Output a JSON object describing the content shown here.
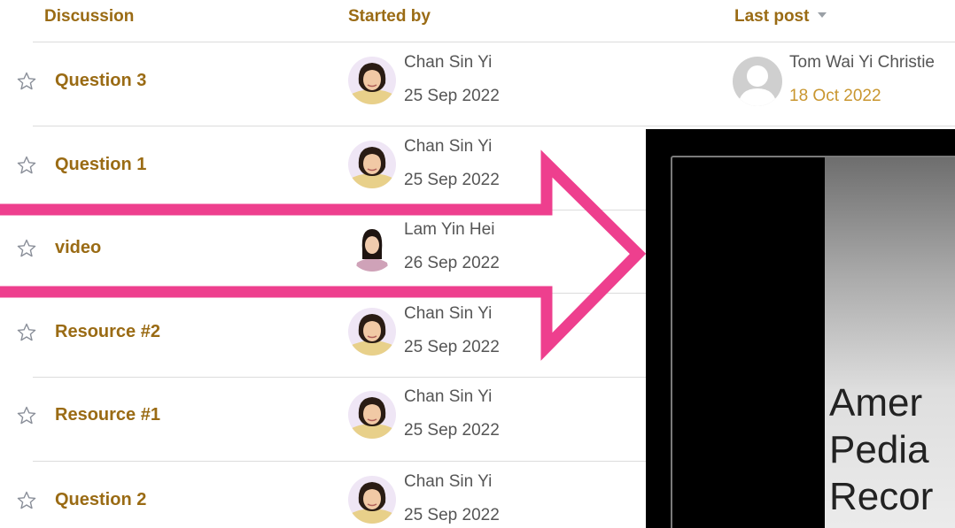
{
  "header": {
    "discussion": "Discussion",
    "started_by": "Started by",
    "last_post": "Last post"
  },
  "rows": [
    {
      "title": "Question 3",
      "author": "Chan Sin Yi",
      "date": "25 Sep 2022",
      "last_post": {
        "name": "Tom Wai Yi Christie",
        "date": "18 Oct 2022"
      }
    },
    {
      "title": "Question 1",
      "author": "Chan Sin Yi",
      "date": "25 Sep 2022"
    },
    {
      "title": "video",
      "author": "Lam Yin Hei",
      "date": "26 Sep 2022"
    },
    {
      "title": "Resource #2",
      "author": "Chan Sin Yi",
      "date": "25 Sep 2022"
    },
    {
      "title": "Resource #1",
      "author": "Chan Sin Yi",
      "date": "25 Sep 2022"
    },
    {
      "title": "Question 2",
      "author": "Chan Sin Yi",
      "date": "25 Sep 2022"
    }
  ],
  "video": {
    "slide_lines": [
      "Amer",
      "Pedia",
      "Recor"
    ]
  },
  "icons": {
    "star": "star-outline-icon",
    "sort": "sort-descending-icon",
    "arrow": "right-arrow-annotation"
  },
  "colors": {
    "accent": "#9a6b14",
    "date_link": "#c9962f",
    "arrow": "#ee3f8e",
    "text": "#555555"
  }
}
